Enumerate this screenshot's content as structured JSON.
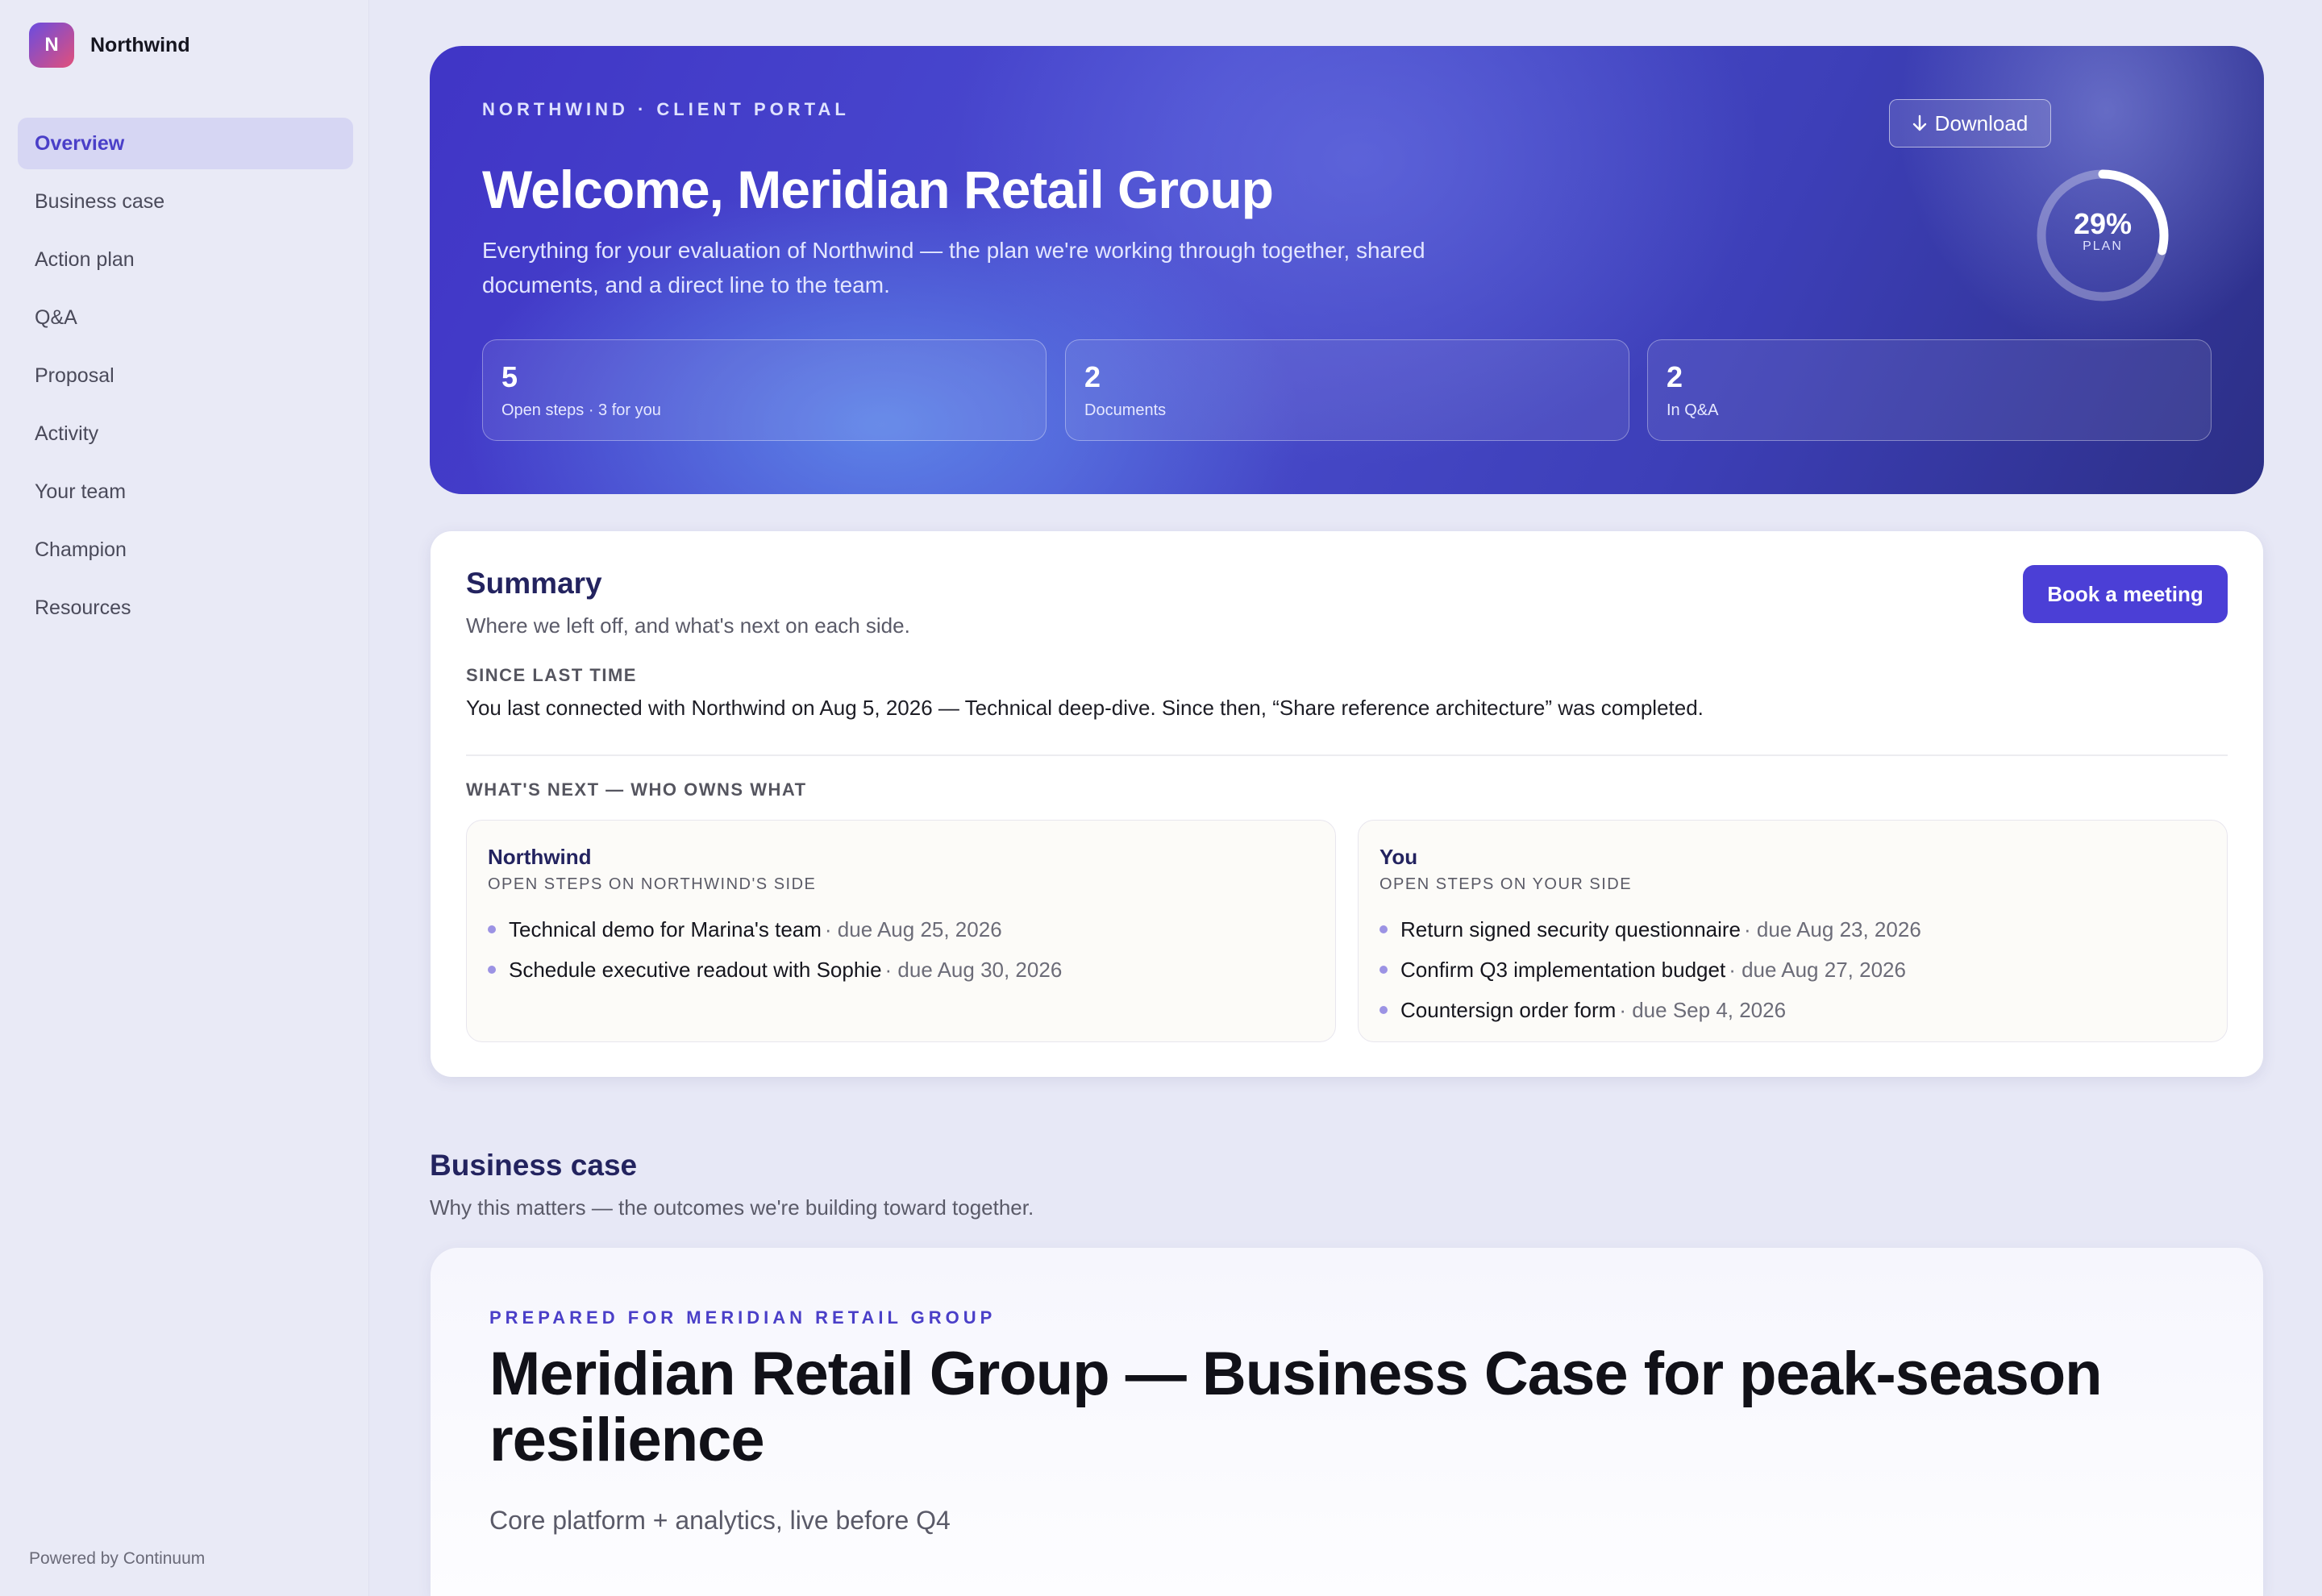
{
  "brand": {
    "logo_letter": "N",
    "name": "Northwind"
  },
  "nav": {
    "items": [
      {
        "label": "Overview",
        "active": true
      },
      {
        "label": "Business case"
      },
      {
        "label": "Action plan"
      },
      {
        "label": "Q&A"
      },
      {
        "label": "Proposal"
      },
      {
        "label": "Activity"
      },
      {
        "label": "Your team"
      },
      {
        "label": "Champion"
      },
      {
        "label": "Resources"
      }
    ]
  },
  "footer": {
    "powered_by": "Powered by Continuum"
  },
  "hero": {
    "kicker": "NORTHWIND · CLIENT PORTAL",
    "title": "Welcome, Meridian Retail Group",
    "subtitle": "Everything for your evaluation of Northwind — the plan we're working through together, shared documents, and a direct line to the team.",
    "download_label": "Download",
    "download_icon": "arrow-down-icon",
    "progress": {
      "percent_label": "29%",
      "label": "PLAN",
      "fraction": 0.29
    },
    "stats": [
      {
        "value": "5",
        "label": "Open steps · 3 for you"
      },
      {
        "value": "2",
        "label": "Documents"
      },
      {
        "value": "2",
        "label": "In Q&A"
      }
    ]
  },
  "summary": {
    "title": "Summary",
    "subtitle": "Where we left off, and what's next on each side.",
    "book_button": "Book a meeting",
    "since_label": "SINCE LAST TIME",
    "since_text": "You last connected with Northwind on Aug 5, 2026 — Technical deep-dive. Since then, “Share reference architecture” was completed.",
    "next_label": "WHAT'S NEXT — WHO OWNS WHAT",
    "owners": [
      {
        "name": "Northwind",
        "sub": "OPEN STEPS ON NORTHWIND'S SIDE",
        "items": [
          {
            "text": "Technical demo for Marina's team",
            "due": "· due Aug 25, 2026"
          },
          {
            "text": "Schedule executive readout with Sophie",
            "due": "· due Aug 30, 2026"
          }
        ]
      },
      {
        "name": "You",
        "sub": "OPEN STEPS ON YOUR SIDE",
        "items": [
          {
            "text": "Return signed security questionnaire",
            "due": "· due Aug 23, 2026"
          },
          {
            "text": "Confirm Q3 implementation budget",
            "due": "· due Aug 27, 2026"
          },
          {
            "text": "Countersign order form",
            "due": "· due Sep 4, 2026"
          }
        ]
      }
    ]
  },
  "business_case": {
    "title": "Business case",
    "subtitle": "Why this matters — the outcomes we're building toward together.",
    "kicker": "PREPARED FOR MERIDIAN RETAIL GROUP",
    "heading": "Meridian Retail Group — Business Case for peak-season resilience",
    "tagline": "Core platform + analytics, live before Q4"
  },
  "colors": {
    "accent": "#4b3fd6",
    "hero_start": "#4035c6",
    "hero_end": "#2c2f86",
    "bullet": "#9c93e4"
  }
}
